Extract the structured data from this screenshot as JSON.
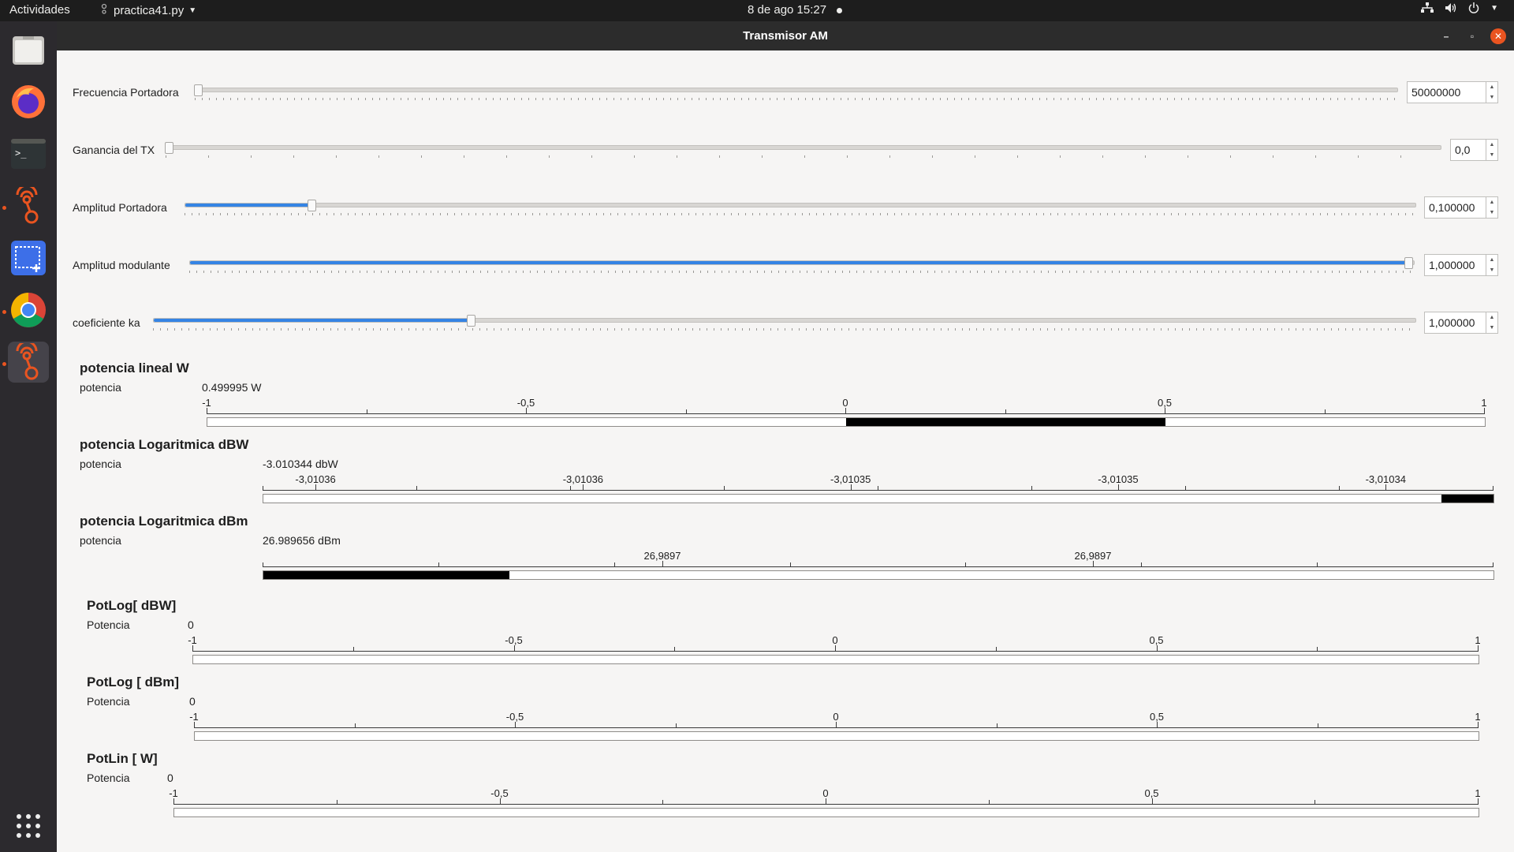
{
  "topbar": {
    "activities": "Actividades",
    "app_name": "practica41.py",
    "clock": "8 de ago  15:27"
  },
  "dock": {
    "items": [
      "files-icon",
      "firefox-icon",
      "terminal-icon",
      "gnuradio-icon",
      "screenshot-icon",
      "chrome-icon",
      "gnuradio-icon",
      "app-grid-icon"
    ]
  },
  "window": {
    "title": "Transmisor AM"
  },
  "controls": {
    "freq": {
      "label": "Frecuencia Portadora",
      "value": "50000000",
      "level": 0.0
    },
    "gain": {
      "label": "Ganancia del TX",
      "value": "0,0",
      "level": 0.0
    },
    "amp_carrier": {
      "label": "Amplitud Portadora",
      "value": "0,100000",
      "level": 0.1
    },
    "amp_mod": {
      "label": "Amplitud modulante",
      "value": "1,000000",
      "level": 1.0
    },
    "ka": {
      "label": "coeficiente ka",
      "value": "1,000000",
      "level": 0.25
    }
  },
  "meters": [
    {
      "title": "potencia lineal W",
      "label": "potencia",
      "value": "0.499995 W",
      "ticklabels": [
        "-1",
        "-0,5",
        "0",
        "0,5",
        "1"
      ],
      "min": -1,
      "max": 1,
      "fill_from": 0,
      "fill_to": 0.5
    },
    {
      "title": "potencia Logaritmica dBW",
      "label": "potencia",
      "value": "-3.010344 dbW",
      "ticklabels": [
        "-3,01036",
        "-3,01036",
        "-3,01035",
        "-3,01035",
        "-3,01034"
      ],
      "fill_from_frac": 0.958,
      "fill_to_frac": 1.0
    },
    {
      "title": "potencia Logaritmica dBm",
      "label": "potencia",
      "value": "26.989656 dBm",
      "ticklabels": [
        "26,9897",
        "26,9897"
      ],
      "fill_from_frac": 0.0,
      "fill_to_frac": 0.2
    },
    {
      "title": "PotLog[ dBW]",
      "label": "Potencia",
      "value": "0",
      "ticklabels": [
        "-1",
        "-0,5",
        "0",
        "0,5",
        "1"
      ]
    },
    {
      "title": "PotLog [ dBm]",
      "label": "Potencia",
      "value": "0",
      "ticklabels": [
        "-1",
        "-0,5",
        "0",
        "0,5",
        "1"
      ]
    },
    {
      "title": "PotLin [ W]",
      "label": "Potencia",
      "value": "0",
      "ticklabels": [
        "-1",
        "-0,5",
        "0",
        "0,5",
        "1"
      ]
    }
  ]
}
